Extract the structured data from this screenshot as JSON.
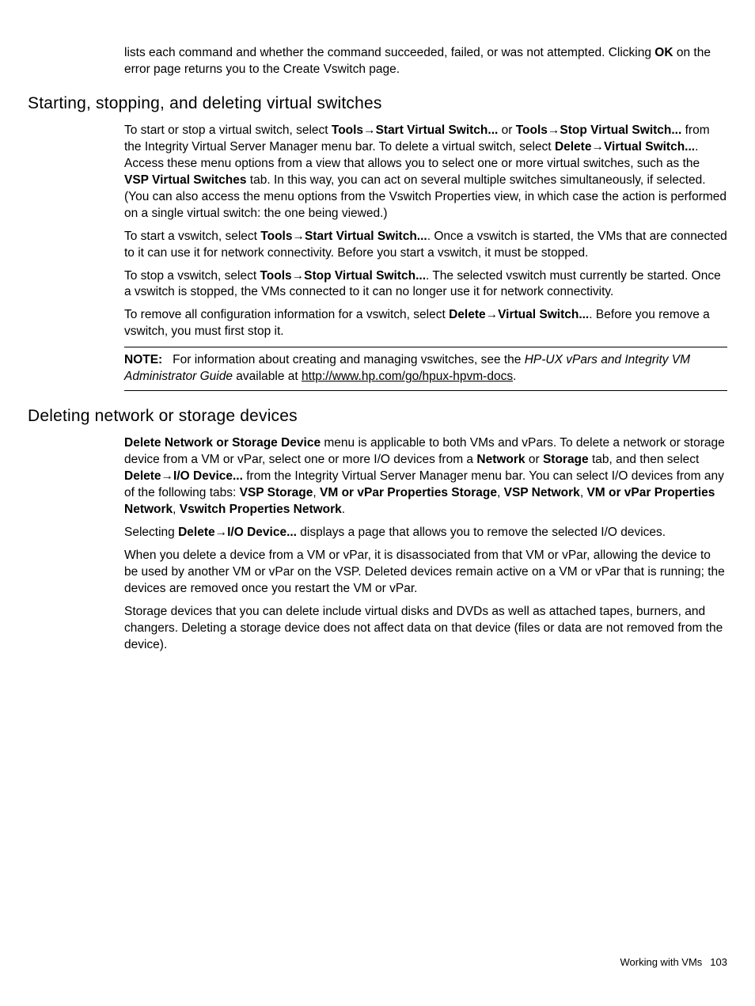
{
  "intro": {
    "p1a": "lists each command and whether the command succeeded, failed, or was not attempted. Clicking ",
    "p1b": "OK",
    "p1c": " on the error page returns you to the Create Vswitch page."
  },
  "section1": {
    "heading": "Starting, stopping, and deleting virtual switches",
    "p1": {
      "t1": "To start or stop a virtual switch, select ",
      "b1": "Tools",
      "b2": "Start Virtual Switch...",
      "t2": " or ",
      "b3": "Tools",
      "b4": "Stop Virtual Switch...",
      "t3": " from the Integrity Virtual Server Manager menu bar. To delete a virtual switch, select ",
      "b5": "Delete",
      "b6": "Virtual Switch...",
      "t4": ". Access these menu options from a view that allows you to select one or more virtual switches, such as the ",
      "b7": "VSP Virtual Switches",
      "t5": " tab. In this way, you can act on several multiple switches simultaneously, if selected. (You can also access the menu options from the Vswitch Properties view, in which case the action is performed on a single virtual switch: the one being viewed.)"
    },
    "p2": {
      "t1": "To start a vswitch, select ",
      "b1": "Tools",
      "b2": "Start Virtual Switch...",
      "t2": ". Once a vswitch is started, the VMs that are connected to it can use it for network connectivity. Before you start a vswitch, it must be stopped."
    },
    "p3": {
      "t1": "To stop a vswitch, select ",
      "b1": "Tools",
      "b2": "Stop Virtual Switch...",
      "t2": ". The selected vswitch must currently be started. Once a vswitch is stopped, the VMs connected to it can no longer use it for network connectivity."
    },
    "p4": {
      "t1": "To remove all configuration information for a vswitch, select ",
      "b1": "Delete",
      "b2": "Virtual Switch...",
      "t2": ". Before you remove a vswitch, you must first stop it."
    },
    "note": {
      "label": "NOTE:",
      "t1": "For information about creating and managing vswitches, see the ",
      "i1": "HP-UX vPars and Integrity VM Administrator Guide",
      "t2": " available at ",
      "link": "http://www.hp.com/go/hpux-hpvm-docs",
      "t3": "."
    }
  },
  "section2": {
    "heading": "Deleting network or storage devices",
    "p1": {
      "b1": "Delete Network or Storage Device",
      "t1": " menu is applicable to both VMs and vPars. To delete a network or storage device from a VM or vPar, select one or more I/O devices from a ",
      "b2": "Network",
      "t2": " or ",
      "b3": "Storage",
      "t3": " tab, and then select ",
      "b4": "Delete",
      "b5": "I/O Device...",
      "t4": " from the Integrity Virtual Server Manager menu bar. You can select I/O devices from any of the following tabs: ",
      "b6": "VSP Storage",
      "t5": ", ",
      "b7": "VM or vPar Properties Storage",
      "t6": ", ",
      "b8": "VSP Network",
      "t7": ", ",
      "b9": "VM or vPar Properties Network",
      "t8": ", ",
      "b10": "Vswitch Properties Network",
      "t9": "."
    },
    "p2": {
      "t1": "Selecting ",
      "b1": "Delete",
      "b2": "I/O Device...",
      "t2": " displays a page that allows you to remove the selected I/O devices."
    },
    "p3": "When you delete a device from a VM or vPar, it is disassociated from that VM or vPar, allowing the device to be used by another VM or vPar on the VSP. Deleted devices remain active on a VM or vPar that is running; the devices are removed once you restart the VM or vPar.",
    "p4": "Storage devices that you can delete include virtual disks and DVDs as well as attached tapes, burners, and changers. Deleting a storage device does not affect data on that device (files or data are not removed from the device)."
  },
  "footer": {
    "text": "Working with VMs",
    "page": "103"
  },
  "glyphs": {
    "arrow": "→"
  }
}
